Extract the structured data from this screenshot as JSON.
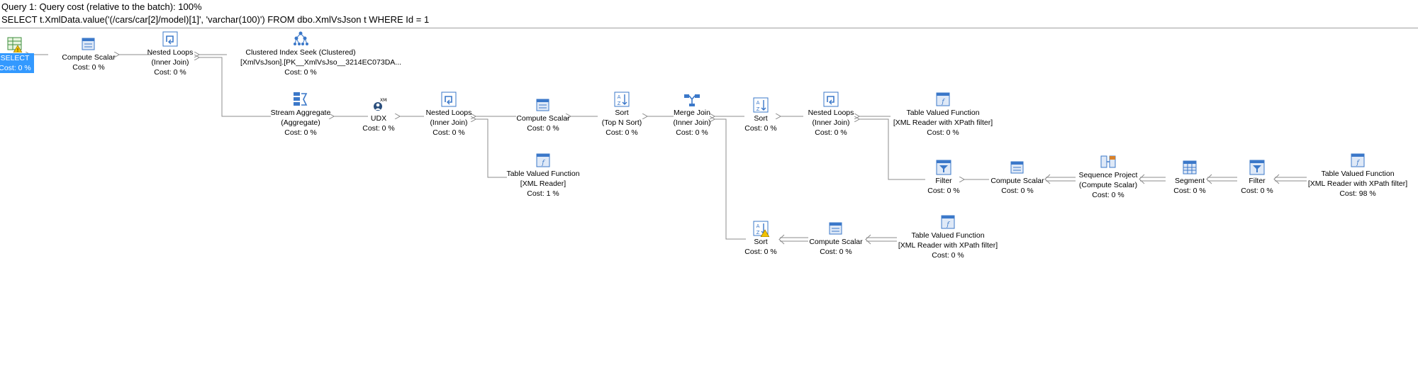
{
  "header": {
    "query_cost": "Query 1: Query cost (relative to the batch): 100%",
    "sql": "SELECT t.XmlData.value('(/cars/car[2]/model)[1]', 'varchar(100)') FROM dbo.XmlVsJson t WHERE Id = 1"
  },
  "nodes": {
    "select": {
      "l1": "SELECT",
      "cost": "Cost: 0 %",
      "icon": "select-icon"
    },
    "cs1": {
      "l1": "Compute Scalar",
      "cost": "Cost: 0 %",
      "icon": "compute-scalar-icon"
    },
    "nl1": {
      "l1": "Nested Loops",
      "l2": "(Inner Join)",
      "cost": "Cost: 0 %",
      "icon": "nested-loops-icon"
    },
    "cis": {
      "l1": "Clustered Index Seek (Clustered)",
      "l2": "[XmlVsJson].[PK__XmlVsJso__3214EC073DA...",
      "cost": "Cost: 0 %",
      "icon": "clustered-index-seek-icon"
    },
    "sa": {
      "l1": "Stream Aggregate",
      "l2": "(Aggregate)",
      "cost": "Cost: 0 %",
      "icon": "stream-aggregate-icon"
    },
    "udx": {
      "l1": "UDX",
      "cost": "Cost: 0 %",
      "icon": "udx-icon"
    },
    "nl2": {
      "l1": "Nested Loops",
      "l2": "(Inner Join)",
      "cost": "Cost: 0 %",
      "icon": "nested-loops-icon"
    },
    "cs2": {
      "l1": "Compute Scalar",
      "cost": "Cost: 0 %",
      "icon": "compute-scalar-icon"
    },
    "tvf1": {
      "l1": "Table Valued Function",
      "l2": "[XML Reader]",
      "cost": "Cost: 1 %",
      "icon": "table-valued-function-icon"
    },
    "sort1": {
      "l1": "Sort",
      "l2": "(Top N Sort)",
      "cost": "Cost: 0 %",
      "icon": "sort-icon"
    },
    "mj": {
      "l1": "Merge Join",
      "l2": "(Inner Join)",
      "cost": "Cost: 0 %",
      "icon": "merge-join-icon"
    },
    "sort2": {
      "l1": "Sort",
      "cost": "Cost: 0 %",
      "icon": "sort-icon"
    },
    "nl3": {
      "l1": "Nested Loops",
      "l2": "(Inner Join)",
      "cost": "Cost: 0 %",
      "icon": "nested-loops-icon"
    },
    "tvf2": {
      "l1": "Table Valued Function",
      "l2": "[XML Reader with XPath filter]",
      "cost": "Cost: 0 %",
      "icon": "table-valued-function-icon"
    },
    "filter1": {
      "l1": "Filter",
      "cost": "Cost: 0 %",
      "icon": "filter-icon"
    },
    "cs3": {
      "l1": "Compute Scalar",
      "cost": "Cost: 0 %",
      "icon": "compute-scalar-icon"
    },
    "sp": {
      "l1": "Sequence Project",
      "l2": "(Compute Scalar)",
      "cost": "Cost: 0 %",
      "icon": "sequence-project-icon"
    },
    "seg": {
      "l1": "Segment",
      "cost": "Cost: 0 %",
      "icon": "segment-icon"
    },
    "filter2": {
      "l1": "Filter",
      "cost": "Cost: 0 %",
      "icon": "filter-icon"
    },
    "tvf3": {
      "l1": "Table Valued Function",
      "l2": "[XML Reader with XPath filter]",
      "cost": "Cost: 98 %",
      "icon": "table-valued-function-icon"
    },
    "sort3": {
      "l1": "Sort",
      "cost": "Cost: 0 %",
      "icon": "sort-icon"
    },
    "cs4": {
      "l1": "Compute Scalar",
      "cost": "Cost: 0 %",
      "icon": "compute-scalar-icon"
    },
    "tvf4": {
      "l1": "Table Valued Function",
      "l2": "[XML Reader with XPath filter]",
      "cost": "Cost: 0 %",
      "icon": "table-valued-function-icon"
    }
  },
  "colors": {
    "selection": "#3399ff",
    "arrow": "#8c8c8c",
    "icon_blue": "#3b78c9",
    "warning": "#f2c200"
  }
}
